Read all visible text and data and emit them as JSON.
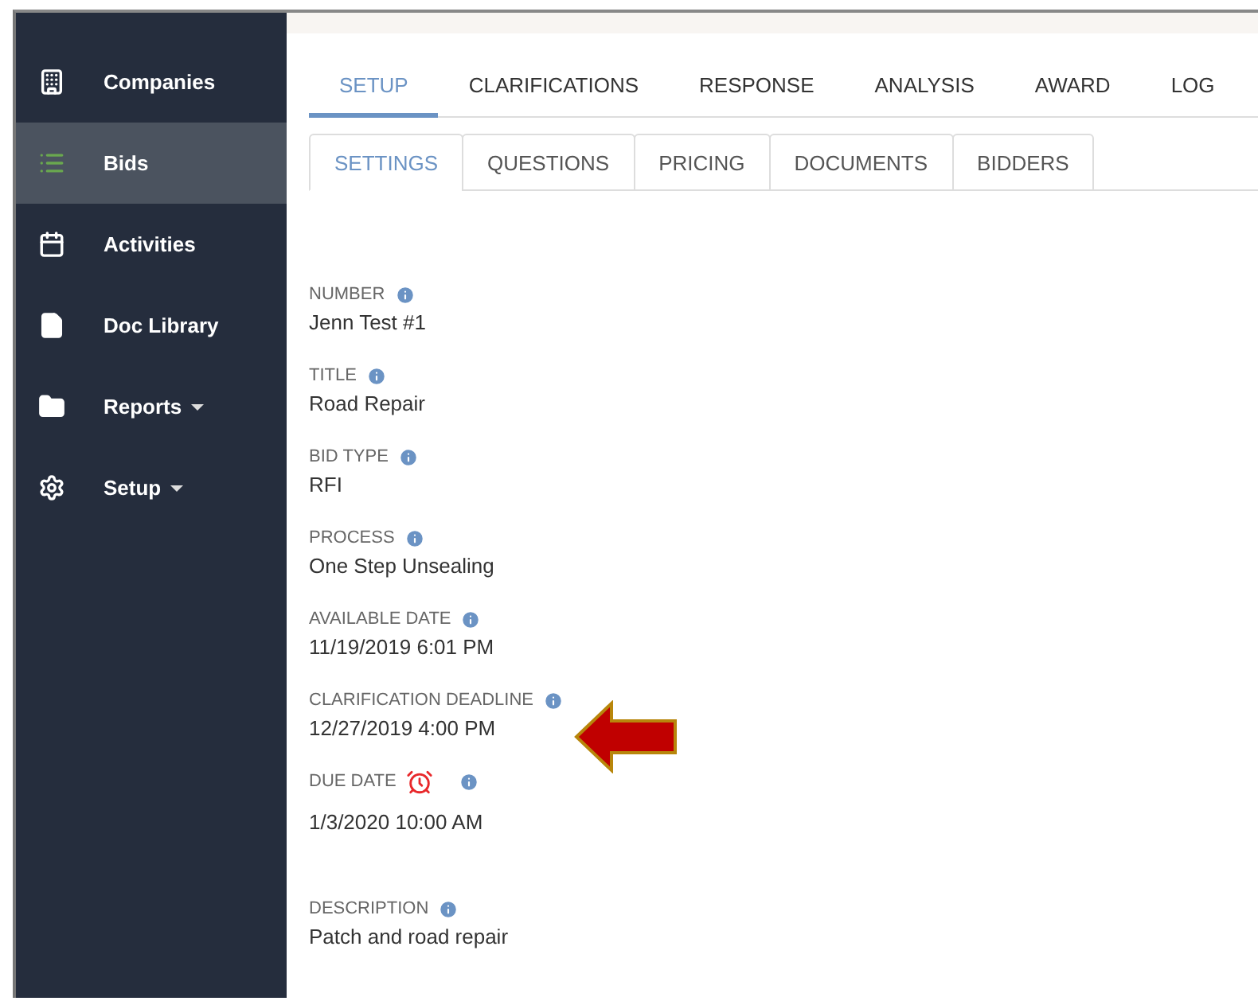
{
  "sidebar": {
    "items": [
      {
        "label": "Companies",
        "selected": false,
        "kind": "link"
      },
      {
        "label": "Bids",
        "selected": true,
        "kind": "link"
      },
      {
        "label": "Activities",
        "selected": false,
        "kind": "link"
      },
      {
        "label": "Doc Library",
        "selected": false,
        "kind": "link"
      },
      {
        "label": "Reports",
        "selected": false,
        "kind": "menu"
      },
      {
        "label": "Setup",
        "selected": false,
        "kind": "menu"
      }
    ]
  },
  "tabs": [
    {
      "label": "SETUP",
      "selected": true
    },
    {
      "label": "CLARIFICATIONS",
      "selected": false
    },
    {
      "label": "RESPONSE",
      "selected": false
    },
    {
      "label": "ANALYSIS",
      "selected": false
    },
    {
      "label": "AWARD",
      "selected": false
    },
    {
      "label": "LOG",
      "selected": false
    }
  ],
  "subtabs": [
    {
      "label": "SETTINGS",
      "selected": true
    },
    {
      "label": "QUESTIONS",
      "selected": false
    },
    {
      "label": "PRICING",
      "selected": false
    },
    {
      "label": "DOCUMENTS",
      "selected": false
    },
    {
      "label": "BIDDERS",
      "selected": false
    }
  ],
  "fields": [
    {
      "label": "NUMBER",
      "value": "Jenn Test #1",
      "kind": "plain"
    },
    {
      "label": "TITLE",
      "value": "Road Repair",
      "kind": "plain"
    },
    {
      "label": "BID TYPE",
      "value": "RFI",
      "kind": "plain"
    },
    {
      "label": "PROCESS",
      "value": "One Step Unsealing",
      "kind": "plain"
    },
    {
      "label": "AVAILABLE DATE",
      "value": "11/19/2019 6:01 PM",
      "kind": "plain"
    },
    {
      "label": "CLARIFICATION DEADLINE",
      "value": "12/27/2019 4:00 PM",
      "kind": "highlighted"
    },
    {
      "label": "DUE DATE",
      "value": "1/3/2020 10:00 AM",
      "kind": "due"
    },
    {
      "label": "DESCRIPTION",
      "value": "Patch and road repair",
      "kind": "plain"
    }
  ]
}
